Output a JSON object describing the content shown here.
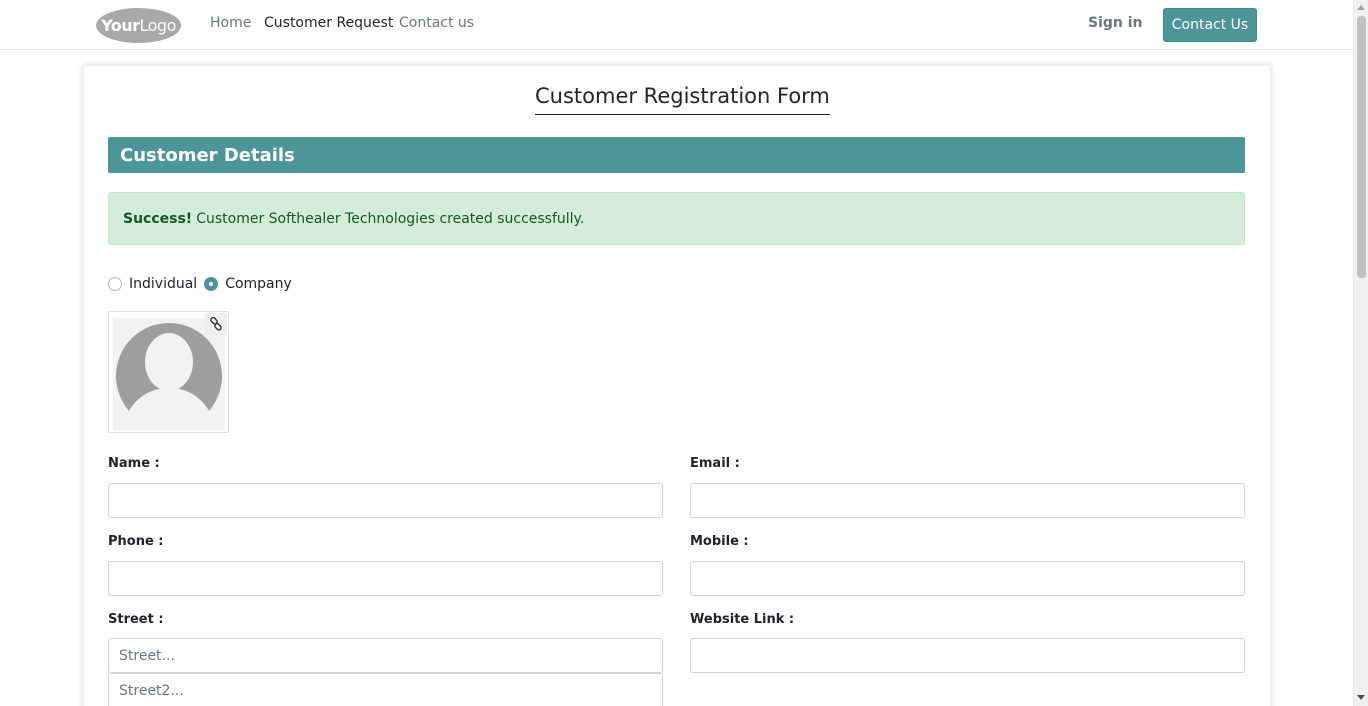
{
  "navbar": {
    "logo_text_bold": "Your",
    "logo_text": "Logo",
    "links": [
      "Home",
      "Customer Request",
      "Contact us"
    ],
    "active_link": "Customer Request",
    "signin": "Sign in",
    "contact_button": "Contact Us",
    "accent_color": "#4d9599"
  },
  "form": {
    "title": "Customer Registration Form",
    "section": "Customer Details",
    "alert": {
      "strong": "Success!",
      "message": "Customer Softhealer Technologies created successfully."
    },
    "customer_type": {
      "options": [
        "Individual",
        "Company"
      ],
      "selected": "Company"
    },
    "avatar_icon": "user-placeholder-icon",
    "link_icon": "link-icon",
    "fields": {
      "name": {
        "label": "Name :",
        "value": ""
      },
      "email": {
        "label": "Email :",
        "value": ""
      },
      "phone": {
        "label": "Phone :",
        "value": ""
      },
      "mobile": {
        "label": "Mobile :",
        "value": ""
      },
      "street": {
        "label": "Street :",
        "placeholder": "Street...",
        "placeholder2": "Street2..."
      },
      "website": {
        "label": "Website Link :",
        "value": ""
      }
    }
  }
}
